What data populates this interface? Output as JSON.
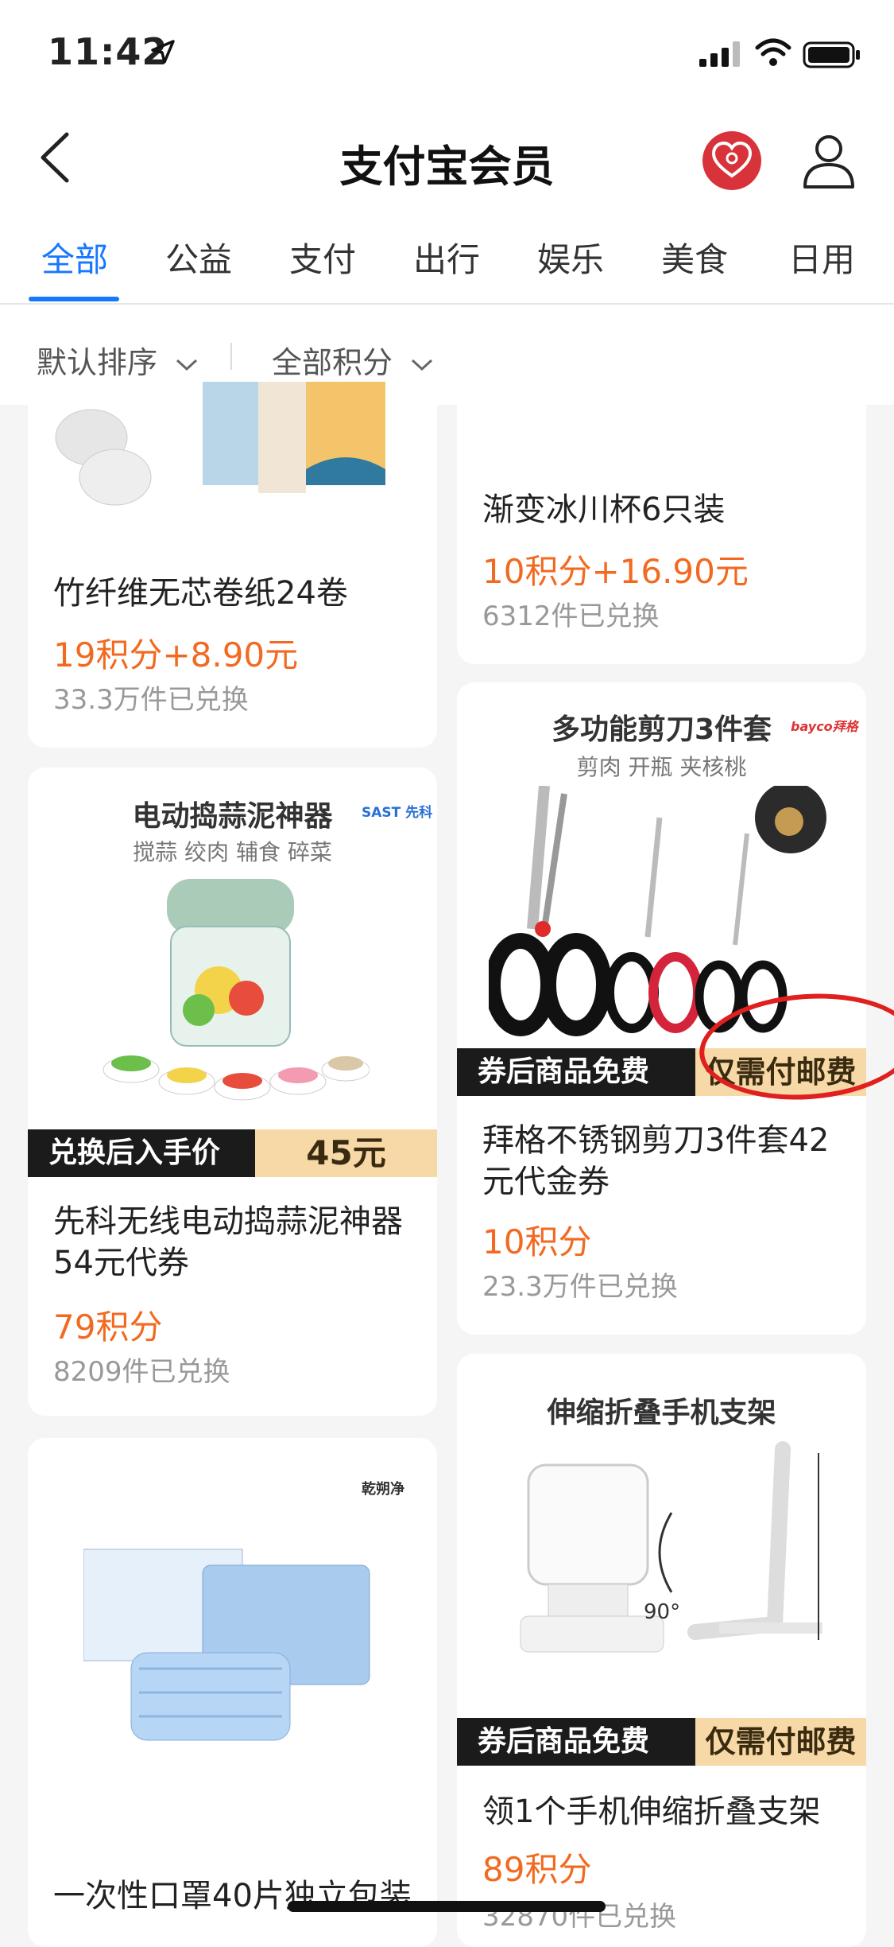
{
  "status_bar": {
    "time": "11:42"
  },
  "nav": {
    "title": "支付宝会员"
  },
  "tabs": [
    "全部",
    "公益",
    "支付",
    "出行",
    "娱乐",
    "美食",
    "日用"
  ],
  "filters": {
    "sort": "默认排序",
    "points": "全部积分"
  },
  "products": [
    {
      "name": "竹纤维无芯卷纸24卷",
      "price": "19积分+8.90元",
      "count": "33.3万件已兑换"
    },
    {
      "name": "渐变冰川杯6只装",
      "price": "10积分+16.90元",
      "count": "6312件已兑换"
    },
    {
      "name": "先科无线电动捣蒜泥神器54元代券",
      "price": "79积分",
      "count": "8209件已兑换",
      "image": {
        "title": "电动捣蒜泥神器",
        "brand": "SAST 先科",
        "sub": "搅蒜  绞肉  辅食  碎菜",
        "banner_left": "兑换后入手价",
        "banner_right": "45元"
      }
    },
    {
      "name": "拜格不锈钢剪刀3件套42元代金券",
      "price": "10积分",
      "count": "23.3万件已兑换",
      "image": {
        "title": "多功能剪刀3件套",
        "brand": "bayco拜格",
        "sub": "剪肉  开瓶  夹核桃",
        "banner_left": "券后商品免费",
        "banner_right": "仅需付邮费"
      }
    },
    {
      "name": "一次性口罩40片独立包装",
      "price": "",
      "count": "",
      "image": {
        "brand": "乾朔净"
      }
    },
    {
      "name": "领1个手机伸缩折叠支架",
      "price": "89积分",
      "count": "32870件已兑换",
      "image": {
        "title": "伸缩折叠手机支架",
        "angle": "90°",
        "banner_left": "券后商品免费",
        "banner_right": "仅需付邮费"
      }
    }
  ],
  "colors": {
    "accent": "#1677ff",
    "price": "#f26a21",
    "heart": "#d8333a",
    "annotation": "#e0201e"
  }
}
